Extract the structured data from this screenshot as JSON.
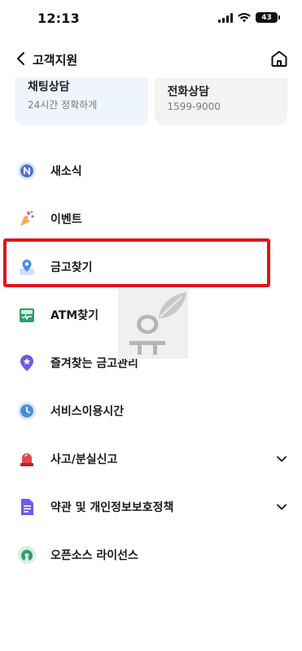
{
  "status": {
    "time": "12:13",
    "battery": "43"
  },
  "header": {
    "title": "고객지원"
  },
  "cards": [
    {
      "title": "채팅상담",
      "subtitle": "24시간 정확하게"
    },
    {
      "title": "전화상담",
      "subtitle": "1599-9000"
    }
  ],
  "menu": [
    {
      "label": "새소식",
      "icon": "news-n-icon",
      "color": "#4a72d9"
    },
    {
      "label": "이벤트",
      "icon": "party-popper-icon",
      "color": "#e35a7a"
    },
    {
      "label": "금고찾기",
      "icon": "location-pin-icon",
      "color": "#4a8de0"
    },
    {
      "label": "ATM찾기",
      "icon": "atm-icon",
      "color": "#2e9e6b"
    },
    {
      "label": "즐겨찾는 금고관리",
      "icon": "star-pin-icon",
      "color": "#6c5ce7"
    },
    {
      "label": "서비스이용시간",
      "icon": "clock-icon",
      "color": "#4a8de0"
    },
    {
      "label": "사고/분실신고",
      "icon": "siren-icon",
      "color": "#e5484d",
      "expandable": true
    },
    {
      "label": "약관 및 개인정보보호정책",
      "icon": "document-icon",
      "color": "#6c5ce7",
      "expandable": true
    },
    {
      "label": "오픈소스 라이선스",
      "icon": "open-source-icon",
      "color": "#2e9e6b"
    }
  ],
  "colors": {
    "highlight": "#e3141b",
    "accent": "#4a8de0"
  }
}
